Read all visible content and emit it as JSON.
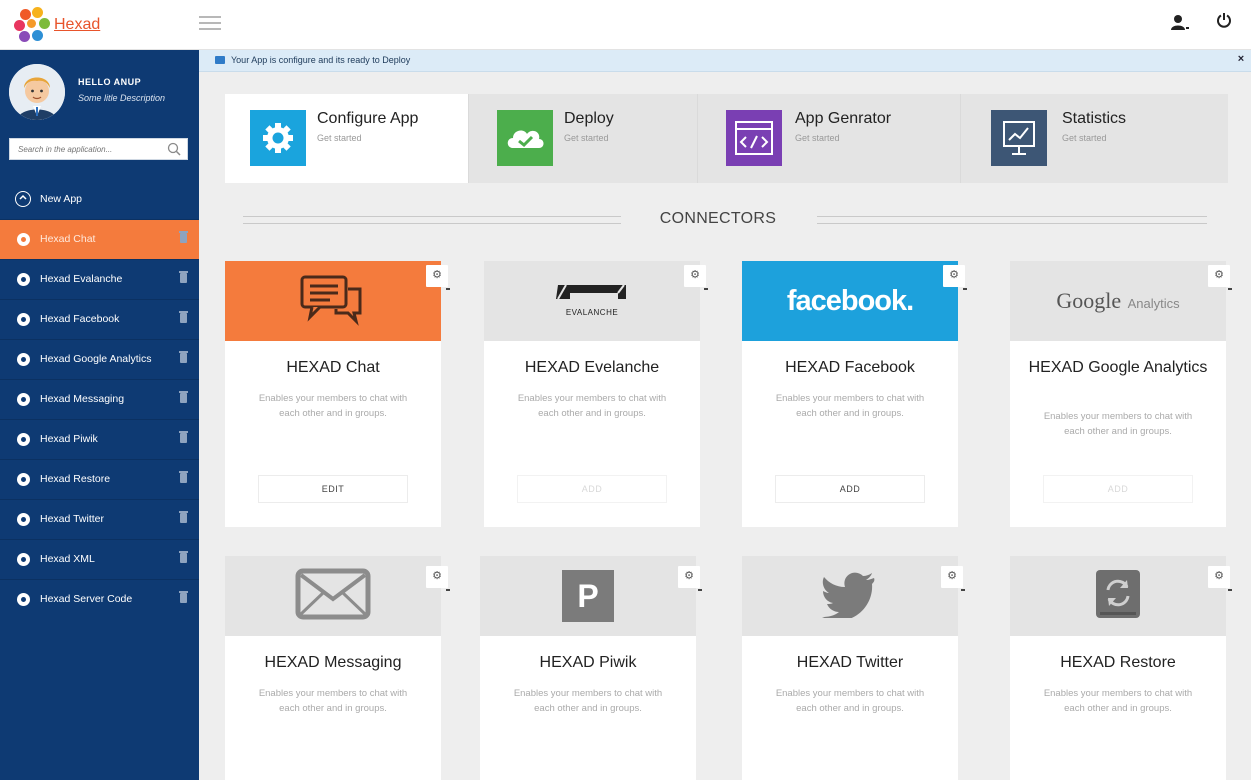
{
  "app": {
    "logo_text": "Hexad"
  },
  "header": {
    "menu_icon": "hamburger-icon",
    "user_icon": "user-icon",
    "power_icon": "power-icon"
  },
  "profile": {
    "greeting": "HELLO ANUP",
    "description": "Some litle Description"
  },
  "search": {
    "placeholder": "Search in the application..."
  },
  "sidebar": {
    "items": [
      {
        "label": "New App"
      },
      {
        "label": "Hexad Chat"
      },
      {
        "label": "Hexad Evalanche"
      },
      {
        "label": "Hexad Facebook"
      },
      {
        "label": "Hexad Google Analytics"
      },
      {
        "label": "Hexad Messaging"
      },
      {
        "label": "Hexad Piwik"
      },
      {
        "label": "Hexad Restore"
      },
      {
        "label": "Hexad Twitter"
      },
      {
        "label": "Hexad XML"
      },
      {
        "label": "Hexad Server Code"
      }
    ]
  },
  "notice": {
    "text": "Your App is configure and its ready to Deploy",
    "close": "×"
  },
  "steps": [
    {
      "title": "Configure App",
      "subtitle": "Get started",
      "color": "#1aa4dd"
    },
    {
      "title": "Deploy",
      "subtitle": "Get started",
      "color": "#4cae4c"
    },
    {
      "title": "App Genrator",
      "subtitle": "Get started",
      "color": "#7a3fb3"
    },
    {
      "title": "Statistics",
      "subtitle": "Get started",
      "color": "#3d5675"
    }
  ],
  "connectors_heading": "CONNECTORS",
  "cards": [
    {
      "title": "HEXAD Chat",
      "text": "Enables your members to chat with each other and in groups.",
      "button": "EDIT",
      "logo": "chat-icon"
    },
    {
      "title": "HEXAD Evelanche",
      "text": "Enables your members to chat with each other and in groups.",
      "button": "ADD",
      "logo": "evalanche-logo",
      "logo_text": "EVALANCHE"
    },
    {
      "title": "HEXAD Facebook",
      "text": "Enables your members to chat with each other and in groups.",
      "button": "ADD",
      "logo": "facebook-logo",
      "logo_text": "facebook."
    },
    {
      "title": "HEXAD Google Analytics",
      "text": "Enables your members to chat with each other and in groups.",
      "button": "ADD",
      "logo": "google-analytics-logo",
      "logo_text": "Google",
      "logo_text2": "Analytics"
    },
    {
      "title": "HEXAD Messaging",
      "text": "Enables your members to chat with each other and in groups.",
      "logo": "envelope-icon"
    },
    {
      "title": "HEXAD Piwik",
      "text": "Enables your members to chat with each other and in groups.",
      "logo": "piwik-logo",
      "logo_text": "P"
    },
    {
      "title": "HEXAD Twitter",
      "text": "Enables your members to chat with each other and in groups.",
      "logo": "twitter-icon"
    },
    {
      "title": "HEXAD Restore",
      "text": "Enables your members to chat with each other and in groups.",
      "logo": "restore-icon"
    }
  ],
  "colors": {
    "sidebar": "#0e3a73",
    "active": "#f47b3d",
    "facebook": "#1da1dc"
  }
}
